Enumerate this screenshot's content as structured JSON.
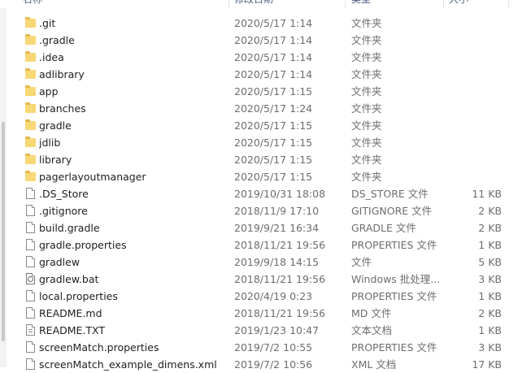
{
  "header": {
    "name_label": "名称",
    "date_label": "修改日期",
    "type_label": "类型",
    "size_label": "大小"
  },
  "files": [
    {
      "name": ".git",
      "date": "2020/5/17 1:14",
      "type": "文件夹",
      "size": "",
      "icon": "folder-icon"
    },
    {
      "name": ".gradle",
      "date": "2020/5/17 1:14",
      "type": "文件夹",
      "size": "",
      "icon": "folder-icon"
    },
    {
      "name": ".idea",
      "date": "2020/5/17 1:14",
      "type": "文件夹",
      "size": "",
      "icon": "folder-icon"
    },
    {
      "name": "adlibrary",
      "date": "2020/5/17 1:14",
      "type": "文件夹",
      "size": "",
      "icon": "folder-icon"
    },
    {
      "name": "app",
      "date": "2020/5/17 1:15",
      "type": "文件夹",
      "size": "",
      "icon": "folder-icon"
    },
    {
      "name": "branches",
      "date": "2020/5/17 1:24",
      "type": "文件夹",
      "size": "",
      "icon": "folder-icon"
    },
    {
      "name": "gradle",
      "date": "2020/5/17 1:15",
      "type": "文件夹",
      "size": "",
      "icon": "folder-icon"
    },
    {
      "name": "jdlib",
      "date": "2020/5/17 1:15",
      "type": "文件夹",
      "size": "",
      "icon": "folder-icon"
    },
    {
      "name": "library",
      "date": "2020/5/17 1:15",
      "type": "文件夹",
      "size": "",
      "icon": "folder-icon"
    },
    {
      "name": "pagerlayoutmanager",
      "date": "2020/5/17 1:15",
      "type": "文件夹",
      "size": "",
      "icon": "folder-icon"
    },
    {
      "name": ".DS_Store",
      "date": "2019/10/31 18:08",
      "type": "DS_STORE 文件",
      "size": "11 KB",
      "icon": "file-icon"
    },
    {
      "name": ".gitignore",
      "date": "2018/11/9 17:10",
      "type": "GITIGNORE 文件",
      "size": "2 KB",
      "icon": "file-icon"
    },
    {
      "name": "build.gradle",
      "date": "2019/9/21 16:34",
      "type": "GRADLE 文件",
      "size": "2 KB",
      "icon": "file-icon"
    },
    {
      "name": "gradle.properties",
      "date": "2018/11/21 19:56",
      "type": "PROPERTIES 文件",
      "size": "1 KB",
      "icon": "file-icon"
    },
    {
      "name": "gradlew",
      "date": "2019/9/18 14:15",
      "type": "文件",
      "size": "5 KB",
      "icon": "file-icon"
    },
    {
      "name": "gradlew.bat",
      "date": "2018/11/21 19:56",
      "type": "Windows 批处理...",
      "size": "3 KB",
      "icon": "batch-file-icon"
    },
    {
      "name": "local.properties",
      "date": "2020/4/19 0:23",
      "type": "PROPERTIES 文件",
      "size": "1 KB",
      "icon": "file-icon"
    },
    {
      "name": "README.md",
      "date": "2018/11/21 19:56",
      "type": "MD 文件",
      "size": "2 KB",
      "icon": "file-icon"
    },
    {
      "name": "README.TXT",
      "date": "2019/1/23 10:47",
      "type": "文本文档",
      "size": "1 KB",
      "icon": "text-file-icon"
    },
    {
      "name": "screenMatch.properties",
      "date": "2019/7/2 10:55",
      "type": "PROPERTIES 文件",
      "size": "3 KB",
      "icon": "file-icon"
    },
    {
      "name": "screenMatch_example_dimens.xml",
      "date": "2019/7/2 10:56",
      "type": "XML 文档",
      "size": "17 KB",
      "icon": "file-icon"
    }
  ]
}
